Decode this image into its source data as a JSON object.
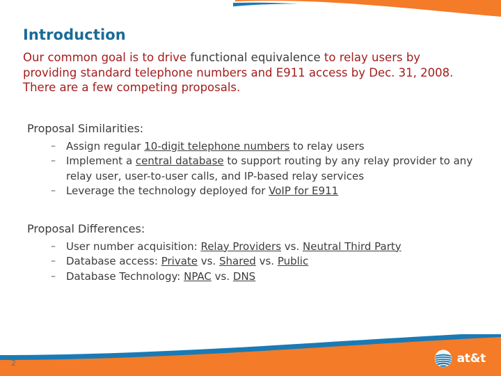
{
  "slide": {
    "title": "Introduction",
    "number": "2",
    "colors": {
      "title": "#1b6a96",
      "accent_orange": "#F47B28",
      "accent_blue": "#1B7AB5",
      "body_red": "#a51c1c",
      "body_gray": "#3c3c3c"
    },
    "lead_paragraph": {
      "part1": "Our common goal is to drive ",
      "highlight": "functional equivalence",
      "part2": " to relay users by providing standard telephone numbers and E911 access by Dec. 31, 2008.  There are a few competing proposals."
    },
    "similarities": {
      "heading": "Proposal Similarities:",
      "items": [
        {
          "pre": "Assign regular ",
          "em": "10-digit telephone numbers",
          "post": " to relay users"
        },
        {
          "pre": "Implement a ",
          "em": "central database",
          "post": " to support routing by any relay provider to any relay user, user-to-user calls, and IP-based relay services"
        },
        {
          "pre": "Leverage the technology deployed for ",
          "em": "VoIP for E911",
          "post": ""
        }
      ]
    },
    "differences": {
      "heading": "Proposal Differences:",
      "items": [
        {
          "pre": "User number acquisition: ",
          "em": "Relay Providers",
          "mid": " vs. ",
          "em2": "Neutral Third Party",
          "post": ""
        },
        {
          "pre": "Database access: ",
          "em": "Private",
          "mid": " vs. ",
          "em2": "Shared",
          "post2": " vs. ",
          "em3": "Public"
        },
        {
          "pre": "Database Technology: ",
          "em": "NPAC",
          "mid": " vs. ",
          "em2": "DNS",
          "post": ""
        }
      ]
    },
    "logo": {
      "name": "att-logo",
      "wordmark": "at&t"
    }
  }
}
